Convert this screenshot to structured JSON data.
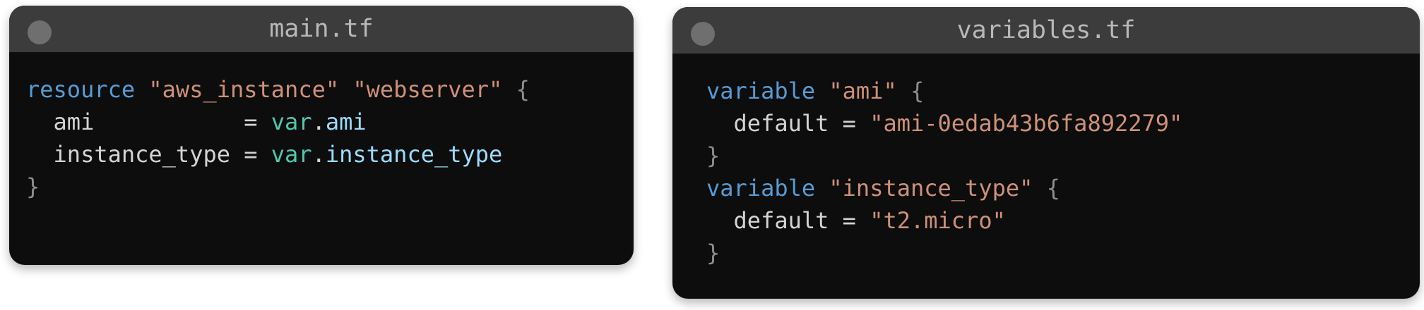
{
  "colors": {
    "window_bg": "#0d0d0d",
    "titlebar_bg": "#3c3c3c",
    "keyword": "#569cd6",
    "string": "#ce9178",
    "identifier": "#d4d4d4",
    "var_keyword": "#4ec9b0",
    "property": "#9cdcfe",
    "brace": "#8d8d8d"
  },
  "main_window": {
    "title": "main.tf",
    "code": {
      "line1": {
        "keyword": "resource",
        "str1": "\"aws_instance\"",
        "str2": "\"webserver\"",
        "brace": "{"
      },
      "line2": {
        "key": "ami",
        "eq": "=",
        "var": "var",
        "dot": ".",
        "prop": "ami"
      },
      "line3": {
        "key": "instance_type",
        "eq": "=",
        "var": "var",
        "dot": ".",
        "prop": "instance_type"
      },
      "line4": {
        "brace": "}"
      }
    }
  },
  "variables_window": {
    "title": "variables.tf",
    "code": {
      "line1": {
        "keyword": "variable",
        "name": "\"ami\"",
        "brace": "{"
      },
      "line2": {
        "key": "default",
        "eq": "=",
        "value": "\"ami-0edab43b6fa892279\""
      },
      "line3": {
        "brace": "}"
      },
      "line4": {
        "keyword": "variable",
        "name": "\"instance_type\"",
        "brace": "{"
      },
      "line5": {
        "key": "default",
        "eq": "=",
        "value": "\"t2.micro\""
      },
      "line6": {
        "brace": "}"
      }
    }
  }
}
